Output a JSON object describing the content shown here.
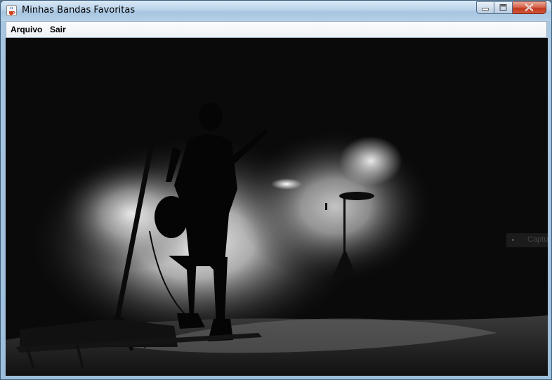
{
  "window": {
    "title": "Minhas Bandas Favoritas"
  },
  "title_bar": {
    "app_icon": "java-cup-icon",
    "controls": {
      "minimize_icon": "minimize-icon",
      "maximize_icon": "maximize-icon",
      "close_icon": "close-icon"
    }
  },
  "menubar": {
    "items": [
      {
        "label": "Arquivo"
      },
      {
        "label": "Sair"
      }
    ]
  },
  "content": {
    "image": "concert-photo",
    "overlay_text": "Captu"
  },
  "colors": {
    "title_bar": "#b9d3ea",
    "close_button": "#c0391f",
    "photo_background": "#0a0a0a"
  }
}
